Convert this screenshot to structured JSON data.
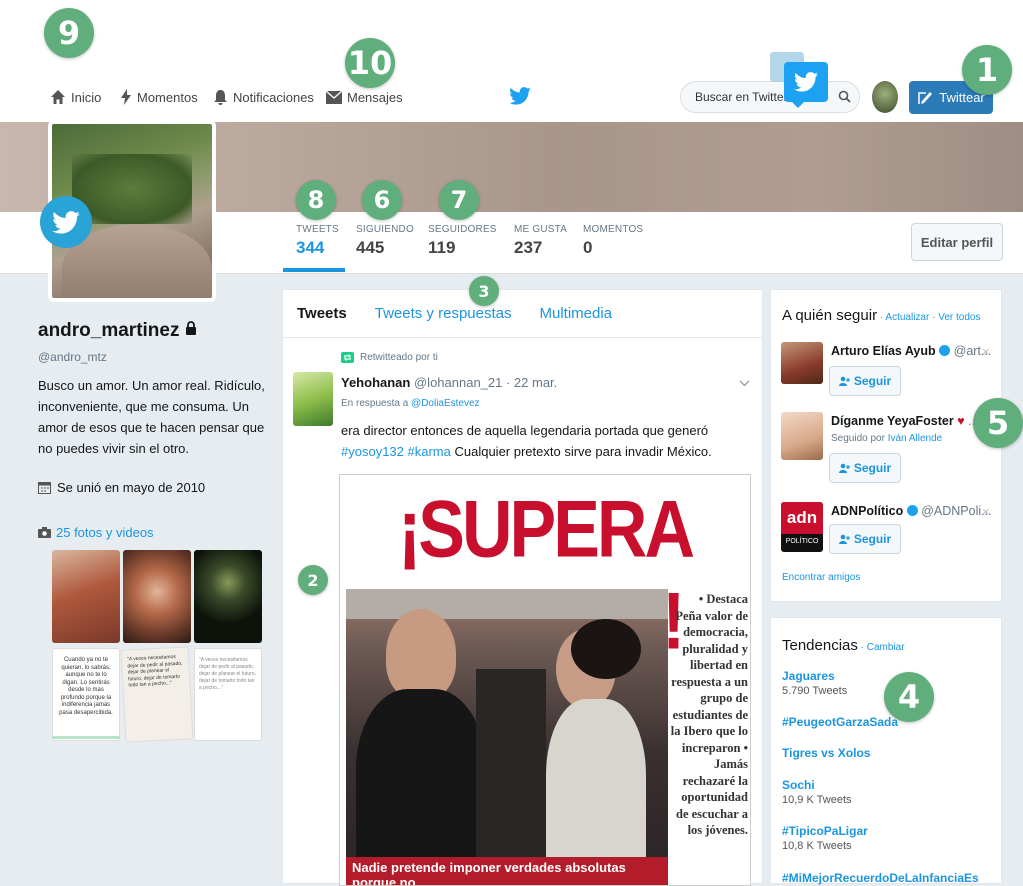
{
  "nav": {
    "home": "Inicio",
    "moments": "Momentos",
    "notifications": "Notificaciones",
    "messages": "Mensajes",
    "search_placeholder": "Buscar en Twitter",
    "tweet_button": "Twittear"
  },
  "badges": {
    "b1": "1",
    "b2": "2",
    "b3": "3",
    "b4": "4",
    "b5": "5",
    "b6": "6",
    "b7": "7",
    "b8": "8",
    "b9": "9",
    "b10": "10"
  },
  "stats": [
    {
      "label": "TWEETS",
      "value": "344"
    },
    {
      "label": "SIGUIENDO",
      "value": "445"
    },
    {
      "label": "SEGUIDORES",
      "value": "119"
    },
    {
      "label": "ME GUSTA",
      "value": "237"
    },
    {
      "label": "MOMENTOS",
      "value": "0"
    }
  ],
  "edit_profile": "Editar perfil",
  "profile": {
    "username": "andro_martinez",
    "handle": "@andro_mtz",
    "bio": "Busco un amor. Un amor real. Ridículo, inconveniente, que me consuma. Un amor de esos que te hacen pensar que no puedes vivir sin el otro.",
    "joined": "Se unió en mayo de 2010",
    "photos_link": "25 fotos y videos",
    "thumb_texts": [
      "Cuando ya no te quieran, lo sabrás, aunque no te lo digan. Lo sentirás desde lo mas profundo porque la indiferencia jamás pasa desapercibida.",
      "\"A veces necesitamos dejar de pedir al pasado, dejar de planear el futuro, dejar de tomarlo todo tan a pecho...\""
    ]
  },
  "timeline": {
    "tabs": [
      "Tweets",
      "Tweets y respuestas",
      "Multimedia"
    ],
    "retweeted_by": "Retwitteado por ti",
    "tweet": {
      "name": "Yehohanan",
      "handle_date": "@lohannan_21 · 22 mar.",
      "reply_prefix": "En respuesta a ",
      "reply_to": "@DoliaEstevez",
      "text_a": "era director entonces de aquella legendaria portada que generó ",
      "hashtag1": "#yosoy132",
      "hashtag2": "#karma",
      "text_b": " Cualquier pretexto sirve para invadir México."
    },
    "newspaper": {
      "headline": "¡SUPERA BOICOT!",
      "column": "• Destaca Peña valor de democracia, pluralidad y libertad en respuesta a un grupo de estudiantes de la Ibero que lo increparon • Jamás rechazaré la oportunidad de escuchar a los jóvenes.",
      "footer": "Nadie pretende imponer verdades absolutas porque no"
    }
  },
  "who_to_follow": {
    "title": "A quién seguir",
    "update": " · Actualizar",
    "view_all": " · Ver todos",
    "follow_label": "Seguir",
    "find_friends": "Encontrar amigos",
    "items": [
      {
        "name": "Arturo Elías Ayub",
        "handle": "@art..."
      },
      {
        "name": "Díganme YeyaFoster",
        "handle": "...",
        "sub_prefix": "Seguido por ",
        "sub_name": "Iván Allende"
      },
      {
        "name": "ADNPolítico",
        "handle": "@ADNPoli..."
      }
    ],
    "adn_logo_top": "adn",
    "adn_logo_bottom": "POLÍTICO"
  },
  "trends": {
    "title": "Tendencias",
    "change": " · Cambiar",
    "items": [
      {
        "name": "Jaguares",
        "count": "5.790 Tweets"
      },
      {
        "name": "#PeugeotGarzaSada",
        "count": ""
      },
      {
        "name": "Tigres vs Xolos",
        "count": ""
      },
      {
        "name": "Sochi",
        "count": "10,9 K Tweets"
      },
      {
        "name": "#TipicoPaLigar",
        "count": "10,8 K Tweets"
      },
      {
        "name": "#MiMejorRecuerdoDeLaInfanciaEs",
        "count": ""
      }
    ]
  },
  "colors": {
    "accent": "#1b95e0",
    "badge": "#5fae7c",
    "tweet_button": "#2b7bb9",
    "headline_red": "#c8102e"
  }
}
